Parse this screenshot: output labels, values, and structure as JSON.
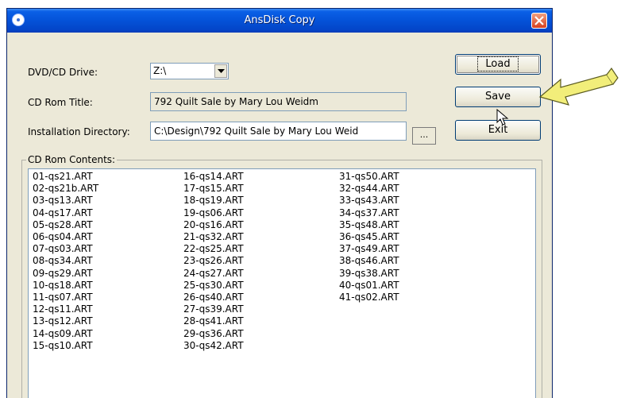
{
  "window": {
    "title": "AnsDisk Copy"
  },
  "labels": {
    "drive": "DVD/CD Drive:",
    "cd_title": "CD Rom Title:",
    "install_dir": "Installation Directory:",
    "contents": "CD Rom Contents:"
  },
  "drive_select": {
    "value": "Z:\\"
  },
  "cd_title_field": {
    "value": "792 Quilt Sale by Mary Lou Weidm"
  },
  "install_dir_field": {
    "value": "C:\\Design\\792 Quilt Sale by Mary Lou Weid"
  },
  "browse_button": {
    "label": "..."
  },
  "buttons": {
    "load": "Load",
    "save": "Save",
    "exit": "Exit"
  },
  "list": {
    "col1": [
      "01-qs21.ART",
      "02-qs21b.ART",
      "03-qs13.ART",
      "04-qs17.ART",
      "05-qs28.ART",
      "06-qs04.ART",
      "07-qs03.ART",
      "08-qs34.ART",
      "09-qs29.ART",
      "10-qs18.ART",
      "11-qs07.ART",
      "12-qs11.ART",
      "13-qs12.ART",
      "14-qs09.ART",
      "15-qs10.ART"
    ],
    "col2": [
      "16-qs14.ART",
      "17-qs15.ART",
      "18-qs19.ART",
      "19-qs06.ART",
      "20-qs16.ART",
      "21-qs32.ART",
      "22-qs25.ART",
      "23-qs26.ART",
      "24-qs27.ART",
      "25-qs30.ART",
      "26-qs40.ART",
      "27-qs39.ART",
      "28-qs41.ART",
      "29-qs36.ART",
      "30-qs42.ART"
    ],
    "col3": [
      "31-qs50.ART",
      "32-qs44.ART",
      "33-qs43.ART",
      "34-qs37.ART",
      "35-qs48.ART",
      "36-qs45.ART",
      "37-qs49.ART",
      "38-qs46.ART",
      "39-qs38.ART",
      "40-qs01.ART",
      "41-qs02.ART"
    ]
  },
  "colors": {
    "titlebar": "#0452d8",
    "face": "#ece9d8",
    "arrow": "#f2ee7a"
  },
  "icons": [
    "window-icon",
    "close-icon",
    "chevron-down-icon",
    "mouse-pointer-icon",
    "pointer-arrow-icon"
  ]
}
